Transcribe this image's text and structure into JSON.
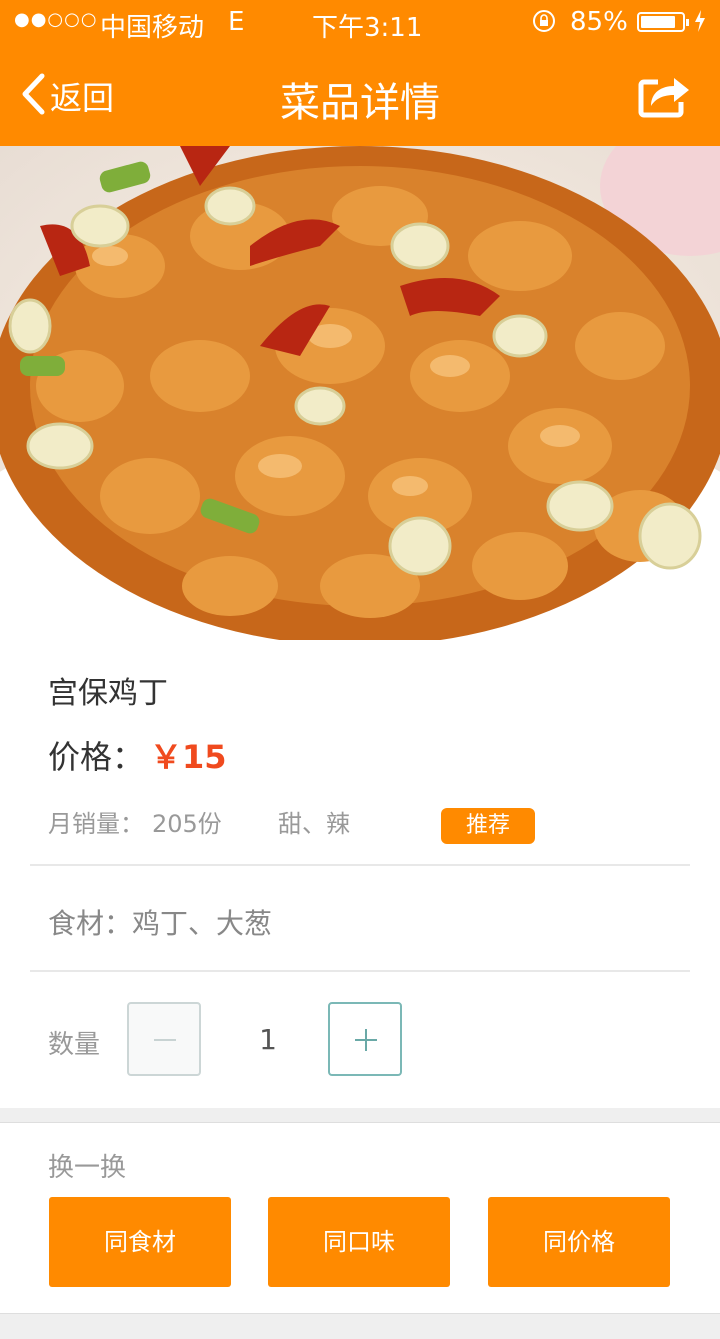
{
  "status_bar": {
    "signal": "●●○○○",
    "carrier": "中国移动",
    "network": "E",
    "time": "下午3:11",
    "battery_pct": "85%",
    "battery_level": 0.85
  },
  "nav": {
    "back_label": "返回",
    "title": "菜品详情"
  },
  "dish": {
    "name": "宫保鸡丁",
    "price_label": "价格：",
    "price": "￥15",
    "sales_label": "月销量：",
    "sales_value": "205份",
    "taste": "甜、辣",
    "badge": "推荐",
    "ingredients": "食材：鸡丁、大葱"
  },
  "quantity": {
    "label": "数量",
    "value": "1"
  },
  "swap": {
    "title": "换一换",
    "buttons": [
      "同食材",
      "同口味",
      "同价格"
    ]
  },
  "colors": {
    "accent": "#ff8a00",
    "price": "#f04a1e"
  }
}
